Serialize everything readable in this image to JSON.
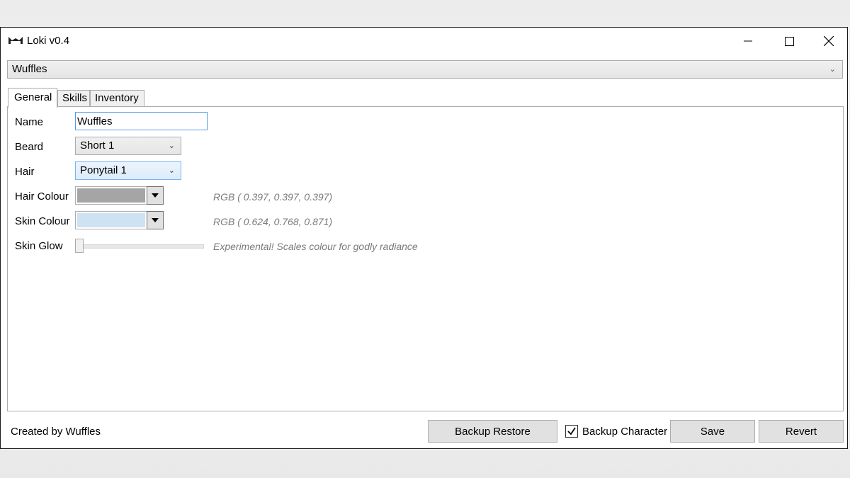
{
  "window": {
    "title": "Loki v0.4",
    "icon": "loki-mask-icon",
    "controls": {
      "minimize": "minimize-icon",
      "maximize": "maximize-icon",
      "close": "close-icon"
    }
  },
  "character_select": {
    "value": "Wuffles",
    "icon": "chevron-down-icon"
  },
  "tabs": [
    {
      "label": "General",
      "active": true
    },
    {
      "label": "Skills",
      "active": false
    },
    {
      "label": "Inventory",
      "active": false
    }
  ],
  "general": {
    "name": {
      "label": "Name",
      "value": "Wuffles"
    },
    "beard": {
      "label": "Beard",
      "value": "Short 1"
    },
    "hair": {
      "label": "Hair",
      "value": "Ponytail 1"
    },
    "hair_colour": {
      "label": "Hair Colour",
      "swatch": "#a5a5a5",
      "rgb_text": "RGB ( 0.397, 0.397, 0.397)"
    },
    "skin_colour": {
      "label": "Skin Colour",
      "swatch": "#cfe2f1",
      "rgb_text": "RGB ( 0.624, 0.768, 0.871)"
    },
    "skin_glow": {
      "label": "Skin Glow",
      "value_fraction": 0.0,
      "hint": "Experimental! Scales colour for godly radiance"
    }
  },
  "footer": {
    "credit": "Created by Wuffles",
    "backup_restore_label": "Backup Restore",
    "backup_character": {
      "label": "Backup Character",
      "checked": true
    },
    "save_label": "Save",
    "revert_label": "Revert"
  }
}
